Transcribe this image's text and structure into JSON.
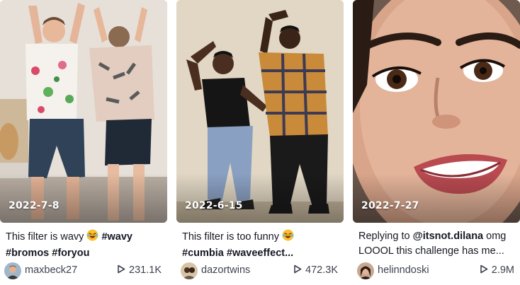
{
  "videos": [
    {
      "date": "2022-7-8",
      "caption_text": "This filter is wavy",
      "caption_emoji": "laughing-emoji",
      "tags_line1": [
        "#wavy"
      ],
      "tags_line2": [
        "#bromos",
        "#foryou"
      ],
      "author": "maxbeck27",
      "views": "231.1K"
    },
    {
      "date": "2022-6-15",
      "caption_text": "This filter is too funny",
      "caption_emoji": "laughing-emoji",
      "tags_line2": [
        "#cumbia",
        "#waveeffect..."
      ],
      "author": "dazortwins",
      "views": "472.3K"
    },
    {
      "date": "2022-7-27",
      "caption_prefix": "Replying to",
      "mention": "@itsnot.dilana",
      "caption_suffix": "omg",
      "caption_line2": "LOOOL this challenge has me...",
      "author": "helinndoski",
      "views": "2.9M"
    }
  ],
  "icons": {
    "play": "play-icon",
    "emoji": "laughing-emoji-icon"
  },
  "colors": {
    "text": "#161823",
    "meta_text": "#3f4350",
    "overlay_text": "#ffffff",
    "emoji_yellow": "#fbc02d"
  }
}
